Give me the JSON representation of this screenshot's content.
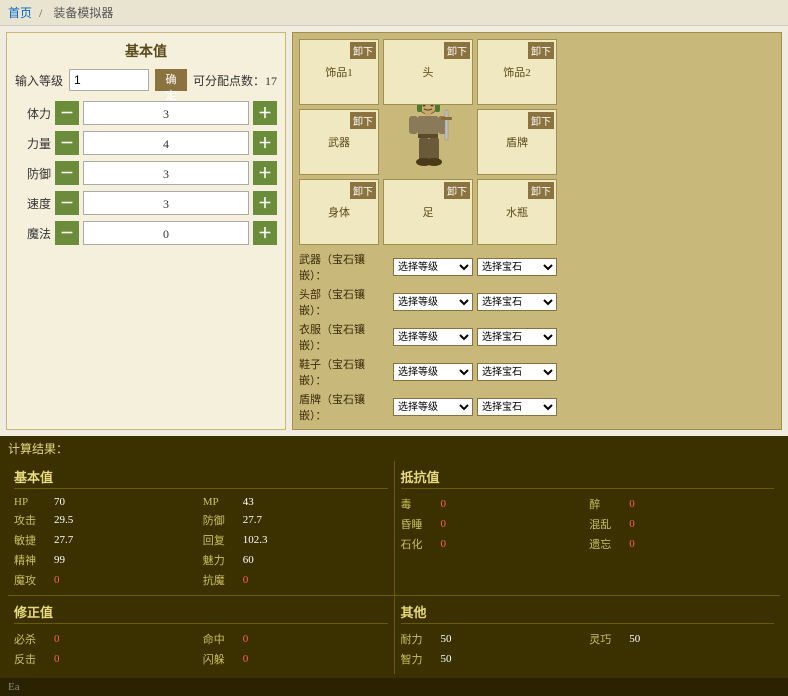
{
  "breadcrumb": {
    "home": "首页",
    "separator": "/",
    "current": "装备模拟器"
  },
  "left_panel": {
    "title": "基本值",
    "level_label": "输入等级",
    "level_value": "1",
    "confirm_btn": "确定",
    "points_label": "可分配点数：17",
    "stats": [
      {
        "name": "体力",
        "value": "3"
      },
      {
        "name": "力量",
        "value": "4"
      },
      {
        "name": "防御",
        "value": "3"
      },
      {
        "name": "速度",
        "value": "3"
      },
      {
        "name": "魔法",
        "value": "0"
      }
    ]
  },
  "equip_panel": {
    "slots": {
      "accessory1": "饰品1",
      "head": "头",
      "accessory2": "饰品2",
      "weapon": "武器",
      "shield": "盾牌",
      "body": "身体",
      "feet": "足",
      "water": "水瓶"
    },
    "unequip_label": "卸下",
    "select_rows": [
      {
        "label": "武器（宝石镶嵌）：",
        "level": "选择等级",
        "gem": "选择宝石"
      },
      {
        "label": "头部（宝石镶嵌）：",
        "level": "选择等级",
        "gem": "选择宝石"
      },
      {
        "label": "衣服（宝石镶嵌）：",
        "level": "选择等级",
        "gem": "选择宝石"
      },
      {
        "label": "鞋子（宝石镶嵌）：",
        "level": "选择等级",
        "gem": "选择宝石"
      },
      {
        "label": "盾牌（宝石镶嵌）：",
        "level": "选择等级",
        "gem": "选择宝石"
      }
    ]
  },
  "results": {
    "label": "计算结果：",
    "basic": {
      "title": "基本值",
      "items": [
        {
          "name": "HP",
          "value": "70"
        },
        {
          "name": "MP",
          "value": "43"
        },
        {
          "name": "攻击",
          "value": "29.5"
        },
        {
          "name": "防御",
          "value": "27.7"
        },
        {
          "name": "敏捷",
          "value": "27.7"
        },
        {
          "name": "回复",
          "value": "102.3"
        },
        {
          "name": "精神",
          "value": "99"
        },
        {
          "name": "魅力",
          "value": "60"
        },
        {
          "name": "魔攻",
          "value": "0",
          "zero": true
        },
        {
          "name": "抗魔",
          "value": "0",
          "zero": true
        }
      ]
    },
    "resist": {
      "title": "抵抗值",
      "items": [
        {
          "name": "毒",
          "value": "0",
          "zero": true
        },
        {
          "name": "醉",
          "value": "0",
          "zero": true
        },
        {
          "name": "昏睡",
          "value": "0",
          "zero": true
        },
        {
          "name": "混乱",
          "value": "0",
          "zero": true
        },
        {
          "name": "石化",
          "value": "0",
          "zero": true
        },
        {
          "name": "遗忘",
          "value": "0",
          "zero": true
        }
      ]
    },
    "modifier": {
      "title": "修正值",
      "items": [
        {
          "name": "必杀",
          "value": "0",
          "zero": true
        },
        {
          "name": "命中",
          "value": "0",
          "zero": true
        },
        {
          "name": "反击",
          "value": "0",
          "zero": true
        },
        {
          "name": "闪躲",
          "value": "0",
          "zero": true
        }
      ]
    },
    "other": {
      "title": "其他",
      "items": [
        {
          "name": "耐力",
          "value": "50"
        },
        {
          "name": "灵巧",
          "value": "50"
        },
        {
          "name": "智力",
          "value": "50"
        }
      ]
    }
  },
  "bottom": {
    "text": "Ea"
  }
}
